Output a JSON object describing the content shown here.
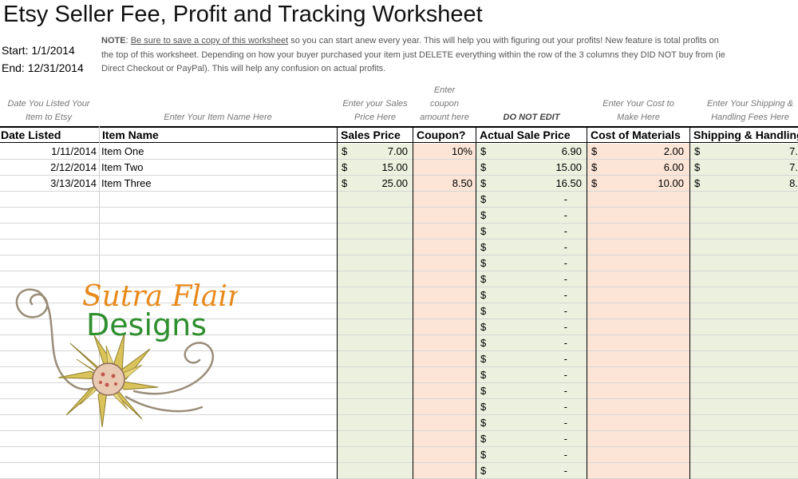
{
  "title": "Etsy Seller Fee, Profit and Tracking Worksheet",
  "period": {
    "start": "Start: 1/1/2014",
    "end": "End: 12/31/2014"
  },
  "note": {
    "label": "NOTE",
    "line1_pre": ": ",
    "underlined": "Be sure to save a copy of this worksheet",
    "line1_post": " so you can start anew every year. This will help you with figuring out your profits! New feature is total profits on",
    "line2": "the top of this worksheet. Depending on how your buyer purchased your item just DELETE everything within the row of the 3 columns they DID NOT buy from (ie",
    "line3": "Direct Checkout or PayPal). This will help any confusion on actual profits."
  },
  "hints": {
    "date": "Date You Listed Your\nItem to Etsy",
    "item": "Enter Your Item Name Here",
    "sales": "Enter your Sales\nPrice Here",
    "coupon": "Enter\ncoupon\namount here",
    "actual": "DO NOT EDIT",
    "cost": "Enter Your Cost to\nMake Here",
    "shipping": "Enter Your Shipping &\nHandling Fees Here"
  },
  "headers": {
    "date": "Date Listed",
    "item": "Item Name",
    "sales": "Sales Price",
    "coupon": "Coupon?",
    "actual": "Actual Sale Price",
    "cost": "Cost of Materials",
    "shipping": "Shipping & Handling"
  },
  "currency_symbol": "$",
  "empty_value": "-",
  "rows": [
    {
      "date": "1/11/2014",
      "item": "Item One",
      "sales": "7.00",
      "coupon": "10%",
      "actual": "6.90",
      "cost": "2.00",
      "shipping": "7."
    },
    {
      "date": "2/12/2014",
      "item": "Item Two",
      "sales": "15.00",
      "coupon": "",
      "actual": "15.00",
      "cost": "6.00",
      "shipping": "7."
    },
    {
      "date": "3/13/2014",
      "item": "Item Three",
      "sales": "25.00",
      "coupon": "8.50",
      "actual": "16.50",
      "cost": "10.00",
      "shipping": "8."
    }
  ],
  "empty_row_count": 18,
  "logo": {
    "line1": "Sutra Flair",
    "line2": "Designs"
  },
  "colors": {
    "green_fill": "#ebf1de",
    "peach_fill": "#fce4d6",
    "logo_orange": "#e8891a",
    "logo_green": "#2f8f2f"
  }
}
